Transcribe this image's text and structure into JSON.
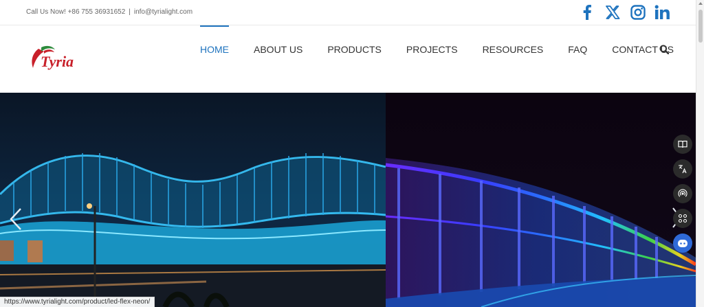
{
  "topbar": {
    "phone": "Call Us Now! +86 755 36931652",
    "separator": "|",
    "email": "info@tyrialight.com",
    "social": [
      "facebook-icon",
      "x-icon",
      "instagram-icon",
      "linkedin-icon"
    ]
  },
  "logo": {
    "text": "Tyria"
  },
  "nav": {
    "items": [
      {
        "label": "HOME",
        "active": true
      },
      {
        "label": "ABOUT US"
      },
      {
        "label": "PRODUCTS"
      },
      {
        "label": "PROJECTS"
      },
      {
        "label": "RESOURCES"
      },
      {
        "label": "FAQ"
      },
      {
        "label": "CONTACT US"
      }
    ],
    "search_icon": "search-icon"
  },
  "colors": {
    "accent": "#1e73be",
    "logo_red": "#c8202a",
    "logo_green": "#2e8b3d"
  },
  "status_url": "https://www.tyrialight.com/product/led-flex-neon/",
  "side_tools": [
    "book-icon",
    "translate-icon",
    "broadcast-icon",
    "apps-icon",
    "assistant-bot-icon"
  ]
}
